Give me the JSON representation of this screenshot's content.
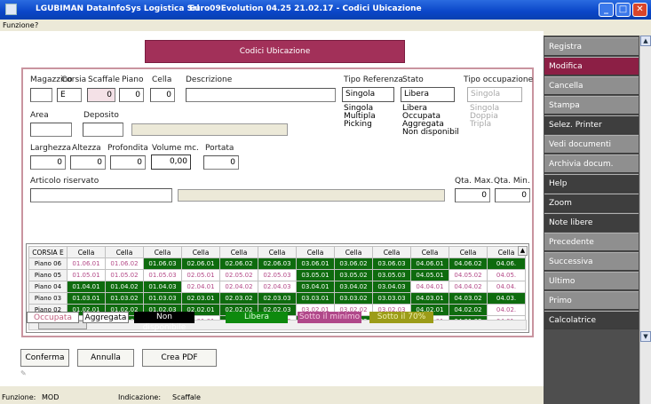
{
  "window": {
    "company": "LGUBIMAN DataInfoSys Logistica Srl",
    "title": "Euro09Evolution 04.25 21.02.17 - Codici Ubicazione",
    "min": "_",
    "max": "□",
    "close": "✕"
  },
  "menu": {
    "item1": "Funzione",
    "item2": "?"
  },
  "header": {
    "title": "Codici Ubicazione"
  },
  "labels": {
    "magazzino": "Magazzino",
    "corsia": "Corsia",
    "scaffale": "Scaffale",
    "piano": "Piano",
    "cella": "Cella",
    "descrizione": "Descrizione",
    "tipo_referenza": "Tipo Referenza",
    "stato": "Stato",
    "tipo_occupazione": "Tipo occupazione",
    "area": "Area",
    "deposito": "Deposito",
    "larghezza": "Larghezza",
    "altezza": "Altezza",
    "profondita": "Profondita",
    "volume": "Volume mc.",
    "portata": "Portata",
    "articolo": "Articolo riservato",
    "qta_max": "Qta. Max.",
    "qta_min": "Qta. Min."
  },
  "values": {
    "magazzino": "",
    "corsia": "E",
    "scaffale": "0",
    "piano": "0",
    "cella": "0",
    "descrizione": "",
    "tipo_referenza": "Singola",
    "stato": "Libera",
    "tipo_occupazione": "Singola",
    "area": "",
    "deposito": "",
    "deposito_desc": "",
    "larghezza": "0",
    "altezza": "0",
    "profondita": "0",
    "volume": "0,00",
    "portata": "0",
    "articolo": "",
    "articolo_desc": "",
    "qta_max": "0",
    "qta_min": "0"
  },
  "tipo_referenza_options": [
    "Singola",
    "Multipla",
    "Picking"
  ],
  "stato_options": [
    "Libera",
    "Occupata",
    "Aggregata",
    "Non disponibil"
  ],
  "tipo_occupazione_options": [
    "Singola",
    "Doppia",
    "Tripla"
  ],
  "grid": {
    "corner": "CORSIA E",
    "col_header": "Cella",
    "rows": [
      {
        "label": "Piano 06",
        "cells": [
          "01.06.01",
          "01.06.02",
          "01.06.03",
          "02.06.01",
          "02.06.02",
          "02.06.03",
          "03.06.01",
          "03.06.02",
          "03.06.03",
          "04.06.01",
          "04.06.02",
          "04.06."
        ],
        "green": [
          false,
          false,
          true,
          true,
          true,
          true,
          true,
          true,
          true,
          true,
          true,
          true
        ]
      },
      {
        "label": "Piano 05",
        "cells": [
          "01.05.01",
          "01.05.02",
          "01.05.03",
          "02.05.01",
          "02.05.02",
          "02.05.03",
          "03.05.01",
          "03.05.02",
          "03.05.03",
          "04.05.01",
          "04.05.02",
          "04.05."
        ],
        "green": [
          false,
          false,
          false,
          false,
          false,
          false,
          true,
          true,
          true,
          true,
          false,
          false
        ]
      },
      {
        "label": "Piano 04",
        "cells": [
          "01.04.01",
          "01.04.02",
          "01.04.03",
          "02.04.01",
          "02.04.02",
          "02.04.03",
          "03.04.01",
          "03.04.02",
          "03.04.03",
          "04.04.01",
          "04.04.02",
          "04.04."
        ],
        "green": [
          true,
          true,
          true,
          false,
          false,
          false,
          true,
          true,
          true,
          false,
          false,
          false
        ]
      },
      {
        "label": "Piano 03",
        "cells": [
          "01.03.01",
          "01.03.02",
          "01.03.03",
          "02.03.01",
          "02.03.02",
          "02.03.03",
          "03.03.01",
          "03.03.02",
          "03.03.03",
          "04.03.01",
          "04.03.02",
          "04.03."
        ],
        "green": [
          true,
          true,
          true,
          true,
          true,
          true,
          true,
          true,
          true,
          true,
          true,
          true
        ]
      },
      {
        "label": "Piano 02",
        "cells": [
          "01.02.01",
          "01.02.02",
          "01.02.03",
          "02.02.01",
          "02.02.02",
          "02.02.03",
          "03.02.01",
          "03.02.02",
          "03.02.03",
          "04.02.01",
          "04.02.02",
          "04.02."
        ],
        "green": [
          true,
          true,
          true,
          true,
          true,
          true,
          false,
          false,
          false,
          true,
          true,
          false
        ]
      },
      {
        "label": "Piano 01",
        "cells": [
          "01.01.01",
          "01.01.02",
          "01.01.03",
          "02.01.01",
          "02.01.02",
          "02.01.03",
          "03.01.01",
          "03.01.02",
          "03.01.03",
          "04.01.01",
          "04.01.02",
          "04.01."
        ],
        "green": [
          false,
          true,
          true,
          false,
          true,
          false,
          true,
          true,
          true,
          false,
          true,
          false
        ]
      }
    ]
  },
  "legend": {
    "occupata": "Occupata",
    "aggregata": "Aggregata",
    "non_disponibile": "Non disponibile",
    "libera": "Libera",
    "sotto_minimo": "Sotto il minimo",
    "sotto_70": "Sotto il 70%"
  },
  "buttons": {
    "conferma": "Conferma",
    "annulla": "Annulla",
    "crea_pdf": "Crea PDF"
  },
  "status": {
    "funzione_label": "Funzione:",
    "funzione_value": "MOD",
    "indicazione_label": "Indicazione:",
    "indicazione_value": "Scaffale"
  },
  "sidebar": [
    "Registra",
    "Modifica",
    "Cancella",
    "Stampa",
    "Selez. Printer",
    "Vedi documenti",
    "Archivia docum.",
    "Help",
    "Zoom",
    "Note libere",
    "Precedente",
    "Successiva",
    "Ultimo",
    "Primo",
    "Calcolatrice"
  ],
  "colors": {
    "accent": "#a23059",
    "green": "#0e6b0e",
    "sidebar": "#8f8f8f",
    "active": "#8c1f45"
  }
}
